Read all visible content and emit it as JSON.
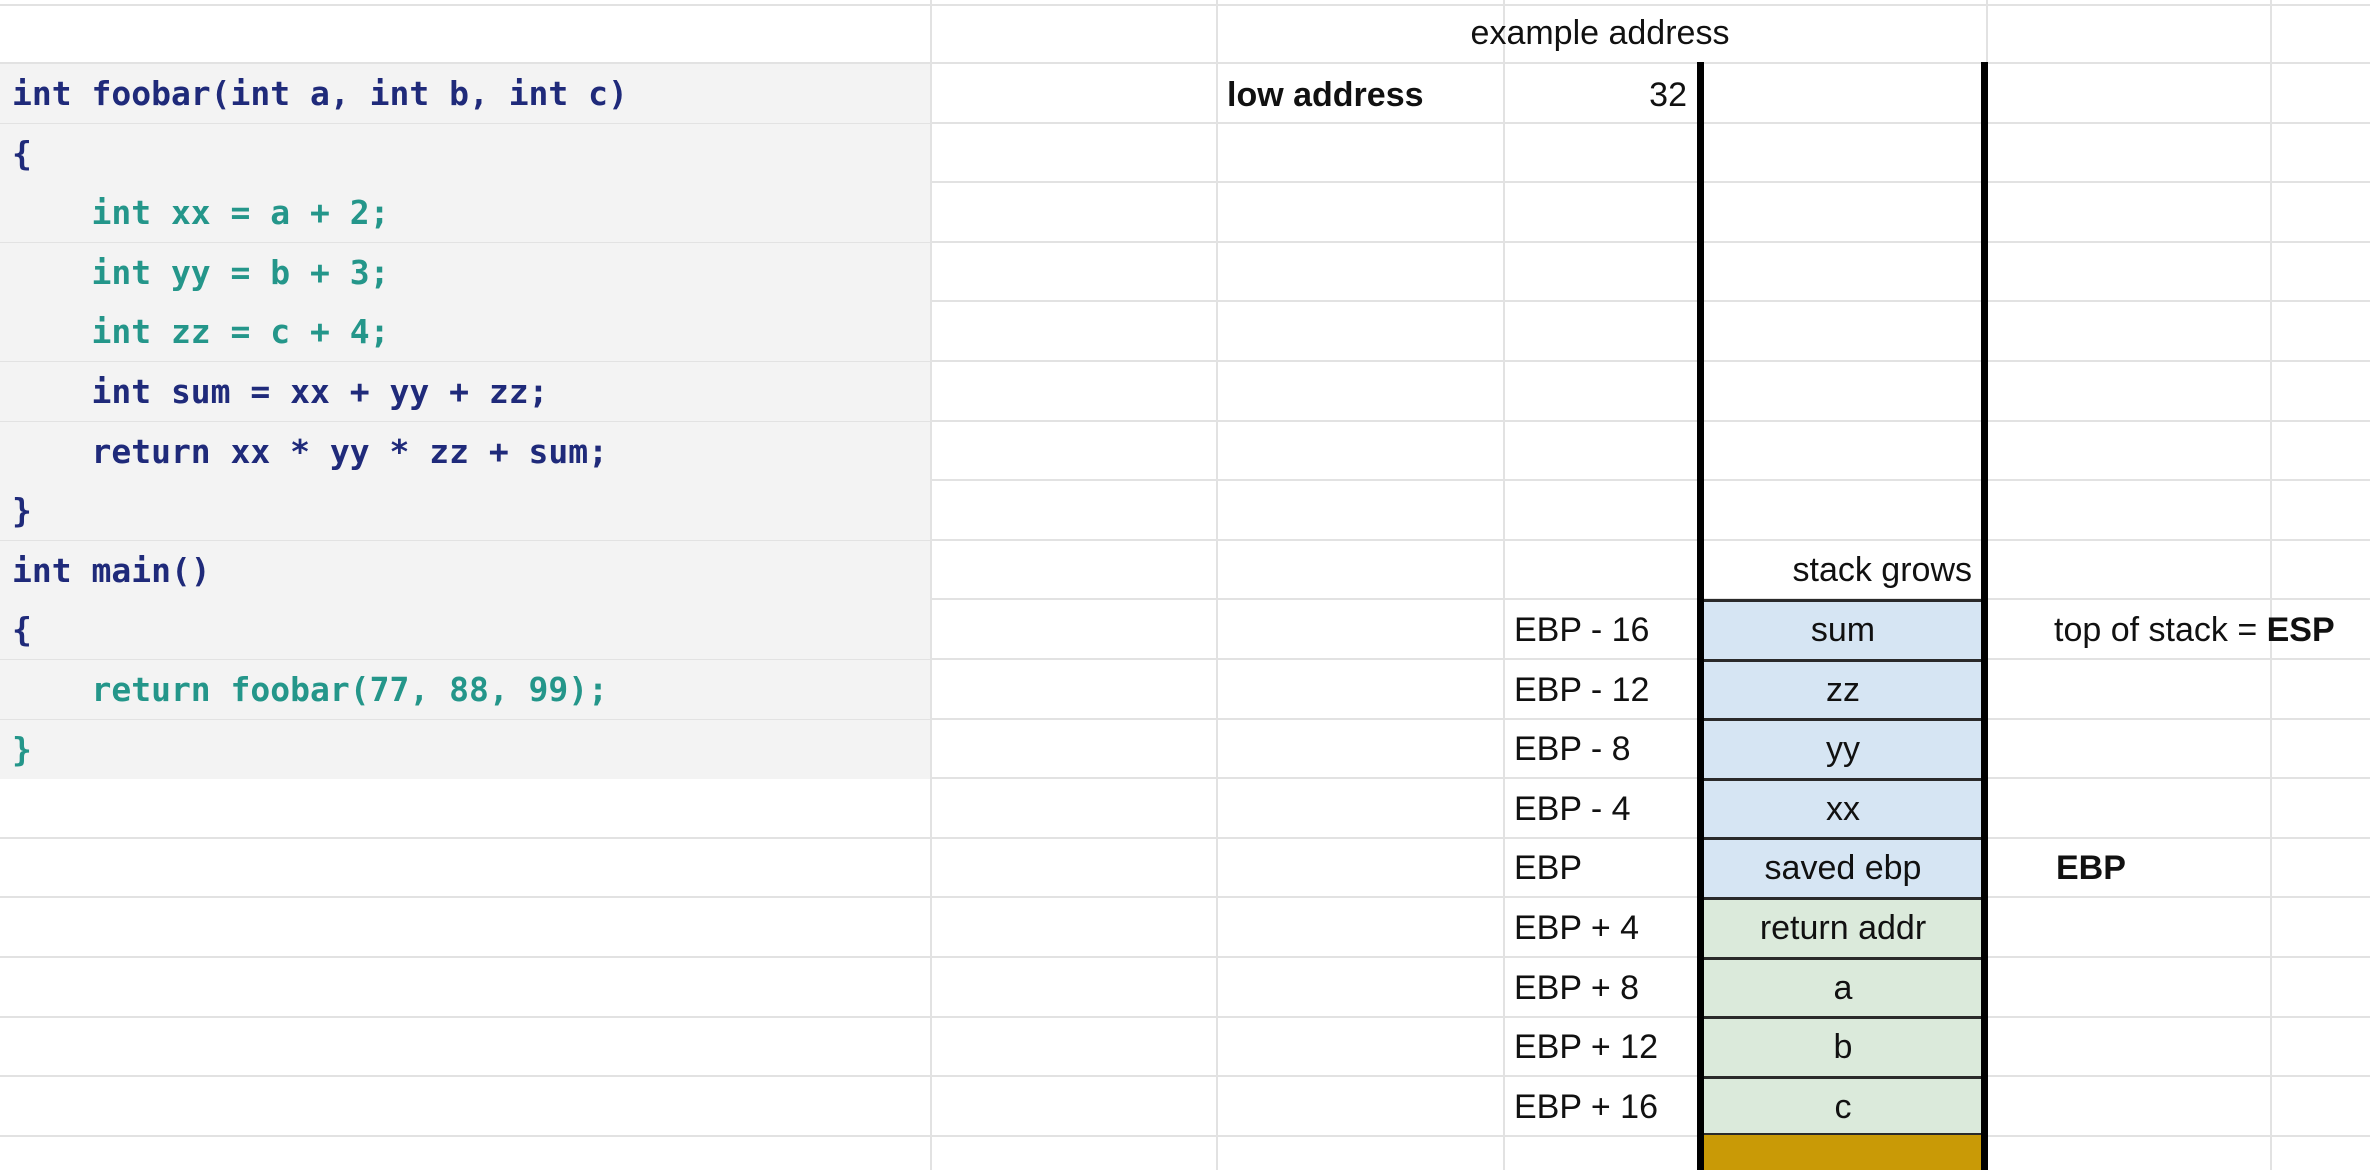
{
  "code_lines": [
    {
      "text": "int foobar(int a, int b, int c)",
      "color": "#1f2a7a"
    },
    {
      "text": "{",
      "color": "#1f2a7a"
    },
    {
      "text": "    int xx = a + 2;",
      "color": "#24968a"
    },
    {
      "text": "    int yy = b + 3;",
      "color": "#24968a"
    },
    {
      "text": "    int zz = c + 4;",
      "color": "#24968a"
    },
    {
      "text": "    int sum = xx + yy + zz;",
      "color": "#1f2a7a"
    },
    {
      "text": "    return xx * yy * zz + sum;",
      "color": "#1f2a7a"
    },
    {
      "text": "}",
      "color": "#1f2a7a"
    },
    {
      "text": "int main()",
      "color": "#1f2a7a"
    },
    {
      "text": "{",
      "color": "#1f2a7a"
    },
    {
      "text": "    return foobar(77, 88, 99);",
      "color": "#24968a"
    },
    {
      "text": "}",
      "color": "#24968a"
    }
  ],
  "header": {
    "example_address": "example address"
  },
  "low_address": {
    "label": "low address",
    "value": "32"
  },
  "stack_grows": "stack grows",
  "stack": [
    {
      "offset": "EBP - 16",
      "name": "sum",
      "fill": "#d6e5f3"
    },
    {
      "offset": "EBP - 12",
      "name": "zz",
      "fill": "#d6e5f3"
    },
    {
      "offset": "EBP - 8",
      "name": "yy",
      "fill": "#d6e5f3"
    },
    {
      "offset": "EBP - 4",
      "name": "xx",
      "fill": "#d6e5f3"
    },
    {
      "offset": "EBP",
      "name": "saved ebp",
      "fill": "#d6e5f3"
    },
    {
      "offset": "EBP + 4",
      "name": "return addr",
      "fill": "#dbeadb"
    },
    {
      "offset": "EBP + 8",
      "name": "a",
      "fill": "#dbeadb"
    },
    {
      "offset": "EBP + 12",
      "name": "b",
      "fill": "#dbeadb"
    },
    {
      "offset": "EBP + 16",
      "name": "c",
      "fill": "#dbeadb"
    }
  ],
  "annotations": {
    "top_of_stack_prefix": "top of stack = ",
    "top_of_stack_reg": "ESP",
    "ebp_marker": "EBP"
  },
  "colors": {
    "frame_locals": "#d6e5f3",
    "frame_args": "#dbeadb",
    "caller_frame": "#c99a06"
  }
}
